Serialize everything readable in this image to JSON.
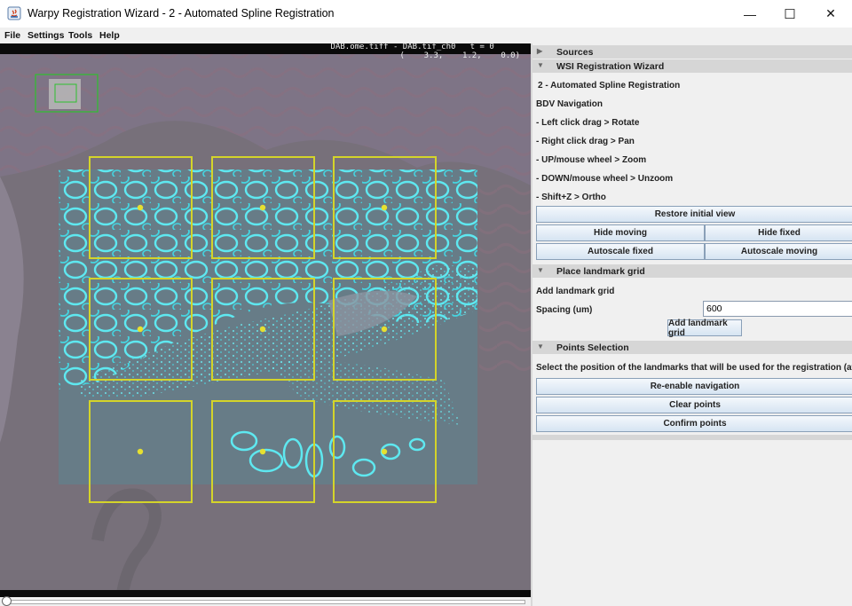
{
  "window": {
    "title": "Warpy Registration Wizard -  2 - Automated Spline Registration",
    "controls": {
      "minimize": "—",
      "maximize": "☐",
      "close": "✕"
    }
  },
  "menu": [
    "File",
    "Settings",
    "Tools",
    "Help"
  ],
  "viewer": {
    "source_info": "DAB.ome.tiff - DAB.tif_ch0   t = 0",
    "coords": "(    3.3,    1.2,    0.0)",
    "grid_rows": 3,
    "grid_cols": 3,
    "colors": {
      "grid": "#d4d42a",
      "tissue_overlay": "#3ee6ee",
      "minimap": "#2ec02e",
      "background": "#77707a"
    }
  },
  "panel": {
    "sources_header": "Sources",
    "wizard_header": "WSI Registration Wizard",
    "step_title": "2 - Automated Spline Registration",
    "bdv_title": "BDV Navigation",
    "nav_help": [
      "- Left click drag > Rotate",
      "- Right click drag > Pan",
      "- UP/mouse wheel > Zoom",
      "- DOWN/mouse wheel > Unzoom",
      "- Shift+Z > Ortho"
    ],
    "buttons": {
      "restore": "Restore initial view",
      "hide_moving": "Hide moving",
      "hide_fixed": "Hide fixed",
      "autoscale_fixed": "Autoscale fixed",
      "autoscale_moving": "Autoscale moving",
      "add_grid": "Add landmark grid",
      "reenable": "Re-enable navigation",
      "clear": "Clear points",
      "confirm": "Confirm points"
    },
    "grid_header": "Place landmark grid",
    "add_grid_label": "Add landmark grid",
    "spacing_label": "Spacing (um)",
    "spacing_value": "600",
    "points_header": "Points Selection",
    "points_help": "Select the position of the landmarks that will be used for the registration (at lea"
  }
}
